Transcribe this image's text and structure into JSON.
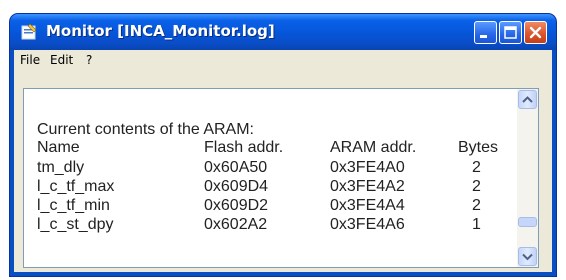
{
  "window": {
    "title": "Monitor [INCA_Monitor.log]"
  },
  "menu": {
    "items": [
      "File",
      "Edit",
      "?"
    ]
  },
  "log": {
    "heading": "Current contents of the ARAM:",
    "columns": [
      "Name",
      "Flash addr.",
      "ARAM addr.",
      "Bytes"
    ],
    "rows": [
      [
        "tm_dly",
        "0x60A50",
        "0x3FE4A0",
        "2"
      ],
      [
        "l_c_tf_max",
        "0x609D4",
        "0x3FE4A2",
        "2"
      ],
      [
        "l_c_tf_min",
        "0x609D2",
        "0x3FE4A4",
        "2"
      ],
      [
        "l_c_st_dpy",
        "0x602A2",
        "0x3FE4A6",
        "1"
      ]
    ]
  },
  "colors": {
    "titlebar": "#0655d8",
    "close_button": "#d9522a",
    "window_bg": "#ece9d8"
  },
  "icons": {
    "app": "monitor-window-icon",
    "minimize": "minimize-icon",
    "maximize": "maximize-icon",
    "close": "close-icon",
    "scroll_up": "scroll-up-icon",
    "scroll_down": "scroll-down-icon"
  }
}
